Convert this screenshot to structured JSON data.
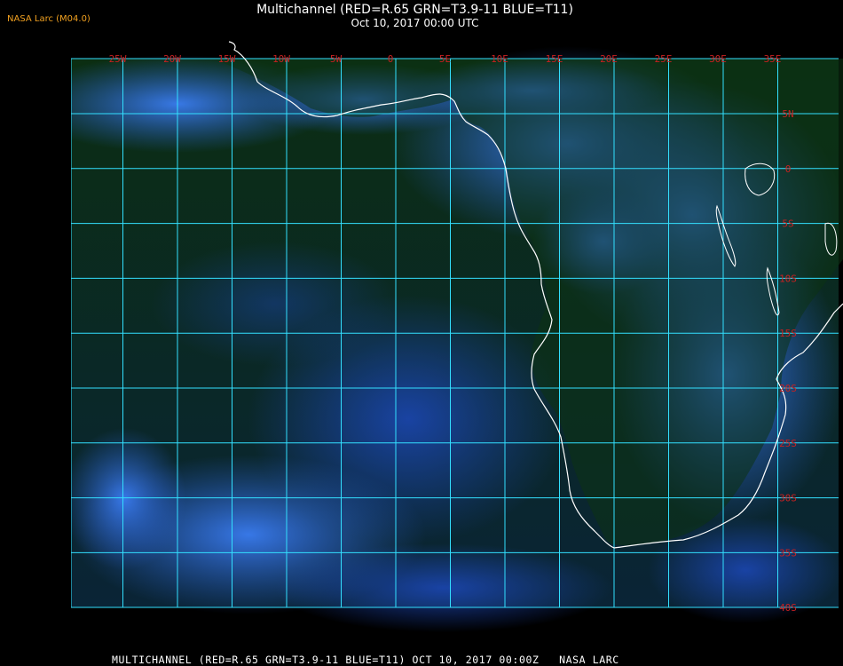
{
  "header": {
    "brand": "NASA Larc (M04.0)",
    "title": "Multichannel (RED=R.65 GRN=T3.9-11 BLUE=T11)",
    "subtitle": "Oct 10, 2017 00:00 UTC"
  },
  "map": {
    "longitude_labels": [
      "25W",
      "20W",
      "15W",
      "10W",
      "5W",
      "0",
      "5E",
      "10E",
      "15E",
      "20E",
      "25E",
      "30E",
      "35E"
    ],
    "latitude_labels": [
      "5N",
      "0",
      "5S",
      "10S",
      "15S",
      "20S",
      "25S",
      "30S",
      "35S",
      "40S"
    ],
    "grid_color": "#33e0ff",
    "label_color": "#c82020",
    "coastline_color": "#ffffff",
    "ocean_color": "#0a2a10",
    "cloud_color": "#2a6ad8"
  },
  "footer": {
    "text": "MULTICHANNEL (RED=R.65 GRN=T3.9-11 BLUE=T11) OCT 10, 2017 00:00Z   NASA LARC"
  }
}
